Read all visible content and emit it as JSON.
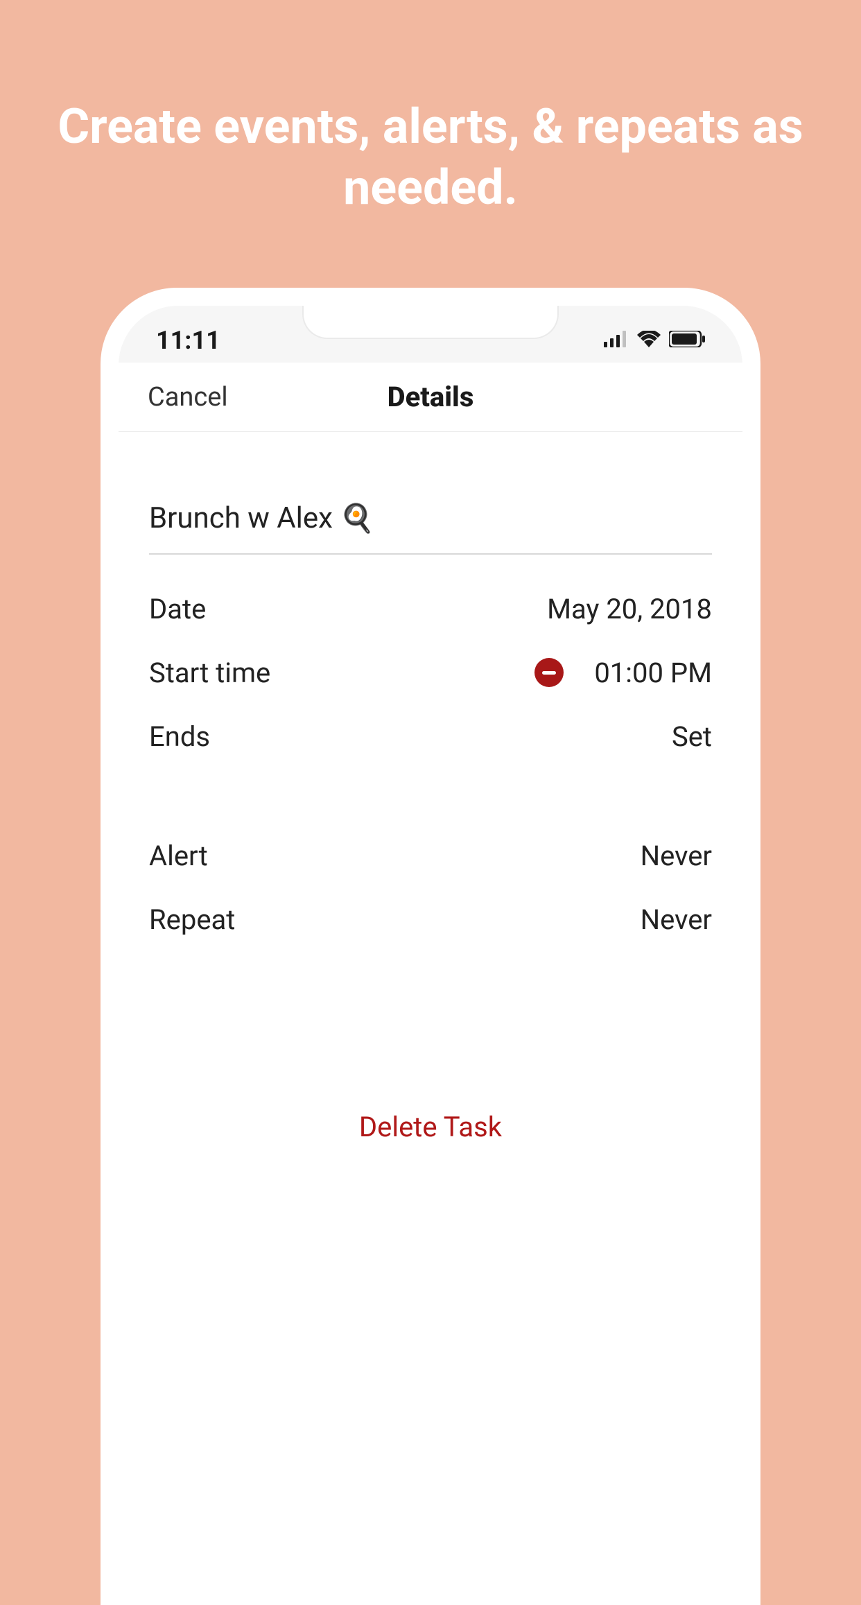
{
  "promo": {
    "headline": "Create events, alerts, & repeats as needed."
  },
  "status": {
    "time": "11:11"
  },
  "nav": {
    "cancel": "Cancel",
    "title": "Details"
  },
  "task": {
    "title": "Brunch w Alex",
    "emoji": "🍳"
  },
  "fields": {
    "date": {
      "label": "Date",
      "value": "May 20, 2018"
    },
    "start": {
      "label": "Start time",
      "value": "01:00 PM"
    },
    "ends": {
      "label": "Ends",
      "value": "Set"
    },
    "alert": {
      "label": "Alert",
      "value": "Never"
    },
    "repeat": {
      "label": "Repeat",
      "value": "Never"
    }
  },
  "actions": {
    "delete": "Delete Task"
  }
}
